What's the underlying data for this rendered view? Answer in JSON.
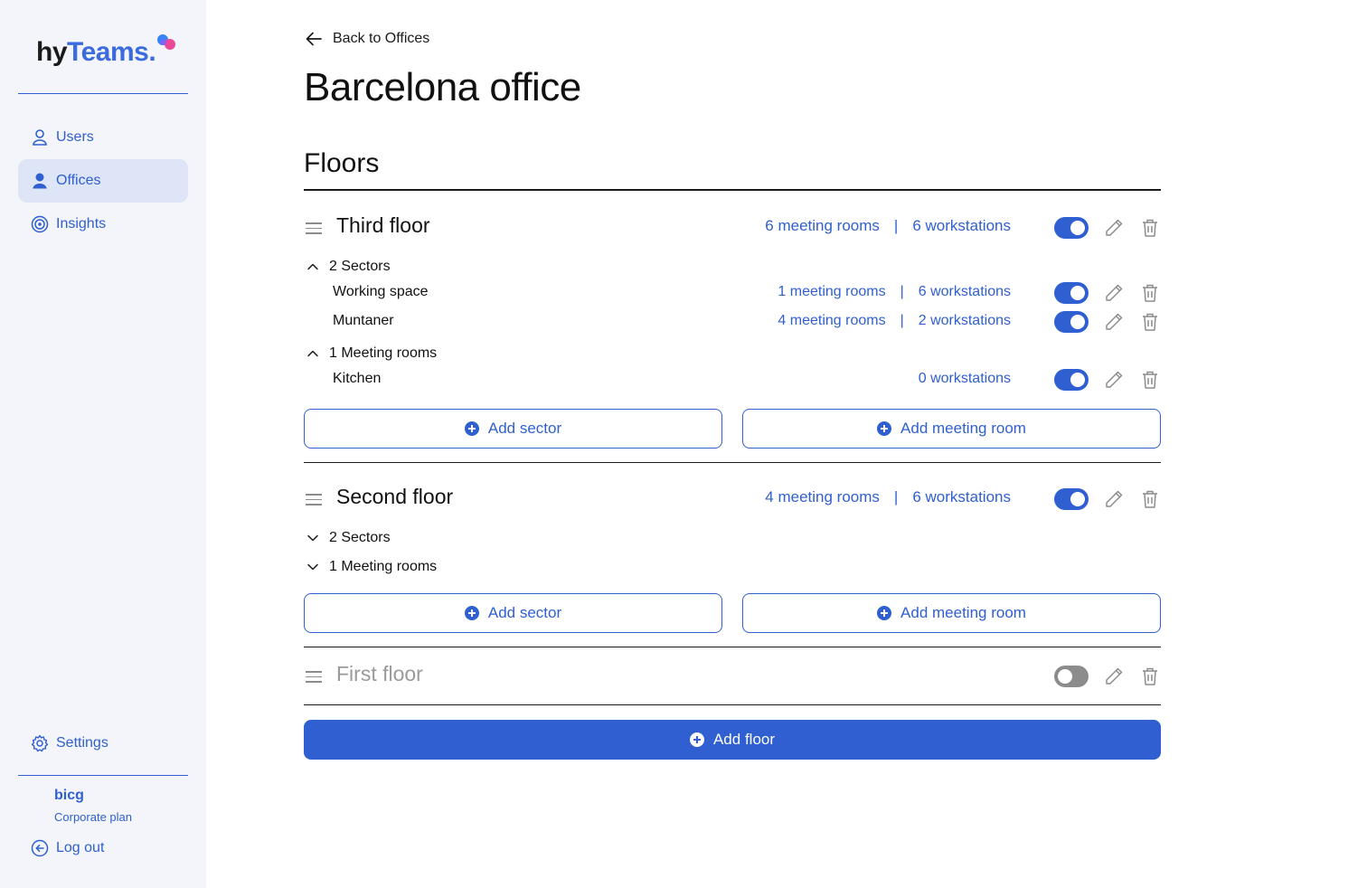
{
  "brand": {
    "logo_part1": "hy",
    "logo_part2": "Teams",
    "logo_dot": ".",
    "colors": {
      "primary": "#2f5fd0",
      "dot_blue": "#3b82f6",
      "dot_pink": "#ec4899",
      "dot_purple": "#8b5cf6"
    }
  },
  "sidebar": {
    "items": [
      {
        "label": "Users",
        "icon": "user-outline-icon",
        "active": false
      },
      {
        "label": "Offices",
        "icon": "user-filled-icon",
        "active": true
      },
      {
        "label": "Insights",
        "icon": "target-icon",
        "active": false
      }
    ],
    "settings_label": "Settings",
    "account": {
      "name": "bicg",
      "plan": "Corporate plan"
    },
    "logout_label": "Log out"
  },
  "main": {
    "back_label": "Back to Offices",
    "title": "Barcelona office",
    "section_title": "Floors",
    "floors": [
      {
        "name": "Third floor",
        "meeting_rooms": "6 meeting rooms",
        "workstations": "6 workstations",
        "enabled": true,
        "groups": [
          {
            "label": "2 Sectors",
            "expanded": true,
            "items": [
              {
                "name": "Working space",
                "meeting_rooms": "1 meeting rooms",
                "workstations": "6 workstations",
                "enabled": true
              },
              {
                "name": "Muntaner",
                "meeting_rooms": "4 meeting rooms",
                "workstations": "2 workstations",
                "enabled": true
              }
            ]
          },
          {
            "label": "1 Meeting rooms",
            "expanded": true,
            "items": [
              {
                "name": "Kitchen",
                "workstations": "0 workstations",
                "enabled": true
              }
            ]
          }
        ],
        "add_sector_label": "Add sector",
        "add_meeting_room_label": "Add meeting room"
      },
      {
        "name": "Second floor",
        "meeting_rooms": "4 meeting rooms",
        "workstations": "6 workstations",
        "enabled": true,
        "groups": [
          {
            "label": "2 Sectors",
            "expanded": false
          },
          {
            "label": "1 Meeting rooms",
            "expanded": false
          }
        ],
        "add_sector_label": "Add sector",
        "add_meeting_room_label": "Add meeting room"
      },
      {
        "name": "First floor",
        "enabled": false
      }
    ],
    "add_floor_label": "Add floor",
    "separator": "|"
  }
}
